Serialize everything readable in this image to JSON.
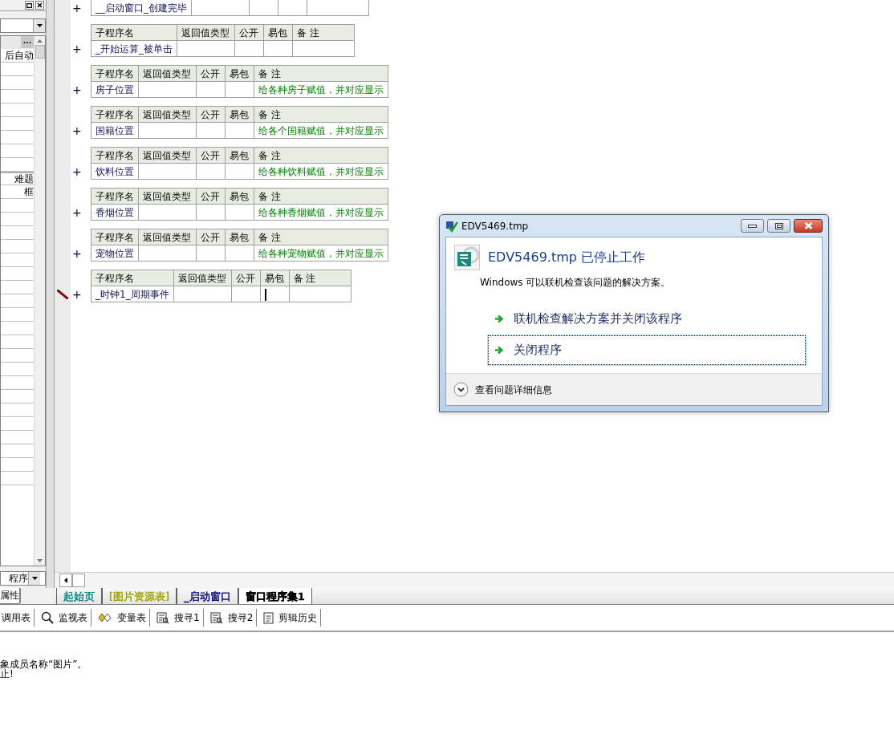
{
  "left_panel": {
    "ellipsis": "···",
    "property_values": [
      "后自动",
      "难题",
      "框"
    ],
    "bottom_combo": "程序",
    "tab": "属性"
  },
  "code": {
    "tables": [
      {
        "marker": "+",
        "editing": false,
        "name": "__启动窗口_创建完毕"
      },
      {
        "marker": "+",
        "header": [
          "子程序名",
          "返回值类型",
          "公开",
          "易包",
          "备 注"
        ],
        "editing": false,
        "name": "_开始运算_被单击"
      },
      {
        "marker": "+",
        "header": [
          "子程序名",
          "返回值类型",
          "公开",
          "易包",
          "备 注"
        ],
        "editing": false,
        "name": "房子位置",
        "note": "给各种房子赋值，并对应显示"
      },
      {
        "marker": "+",
        "header": [
          "子程序名",
          "返回值类型",
          "公开",
          "易包",
          "备 注"
        ],
        "editing": false,
        "name": "国籍位置",
        "note": "给各个国籍赋值，并对应显示"
      },
      {
        "marker": "+",
        "header": [
          "子程序名",
          "返回值类型",
          "公开",
          "易包",
          "备 注"
        ],
        "editing": false,
        "name": "饮料位置",
        "note": "给各种饮料赋值，并对应显示"
      },
      {
        "marker": "+",
        "header": [
          "子程序名",
          "返回值类型",
          "公开",
          "易包",
          "备 注"
        ],
        "editing": false,
        "name": "香烟位置",
        "note": "给各种香烟赋值，并对应显示"
      },
      {
        "marker": "+",
        "header": [
          "子程序名",
          "返回值类型",
          "公开",
          "易包",
          "备 注"
        ],
        "editing": false,
        "name": "宠物位置",
        "note": "给各种宠物赋值，并对应显示"
      },
      {
        "marker": "+",
        "header": [
          "子程序名",
          "返回值类型",
          "公开",
          "易包",
          "备 注"
        ],
        "editing": true,
        "name": "_时钟1_周期事件"
      }
    ]
  },
  "tabs": [
    {
      "label": "起始页",
      "color": "#008080",
      "selected": false
    },
    {
      "label": "[图片资源表]",
      "color": "#a0a000",
      "selected": false
    },
    {
      "label": "_启动窗口",
      "color": "#000080",
      "selected": false
    },
    {
      "label": "窗口程序集1",
      "color": "#000000",
      "selected": true
    }
  ],
  "toolbar": [
    {
      "label": "调用表",
      "kind": "plain"
    },
    {
      "label": "监视表",
      "kind": "watch"
    },
    {
      "label": "变量表",
      "kind": "variables"
    },
    {
      "label": "搜寻1",
      "kind": "find"
    },
    {
      "label": "搜寻2",
      "kind": "find"
    },
    {
      "label": "剪辑历史",
      "kind": "history"
    }
  ],
  "output": [
    "象成员名称“图片”。",
    "止!"
  ],
  "dialog": {
    "title": "EDV5469.tmp",
    "heading": "EDV5469.tmp 已停止工作",
    "message": "Windows 可以联机检查该问题的解决方案。",
    "options": [
      {
        "label": "联机检查解决方案并关闭该程序",
        "selected": false
      },
      {
        "label": "关闭程序",
        "selected": true
      }
    ],
    "details": "查看问题详细信息"
  }
}
